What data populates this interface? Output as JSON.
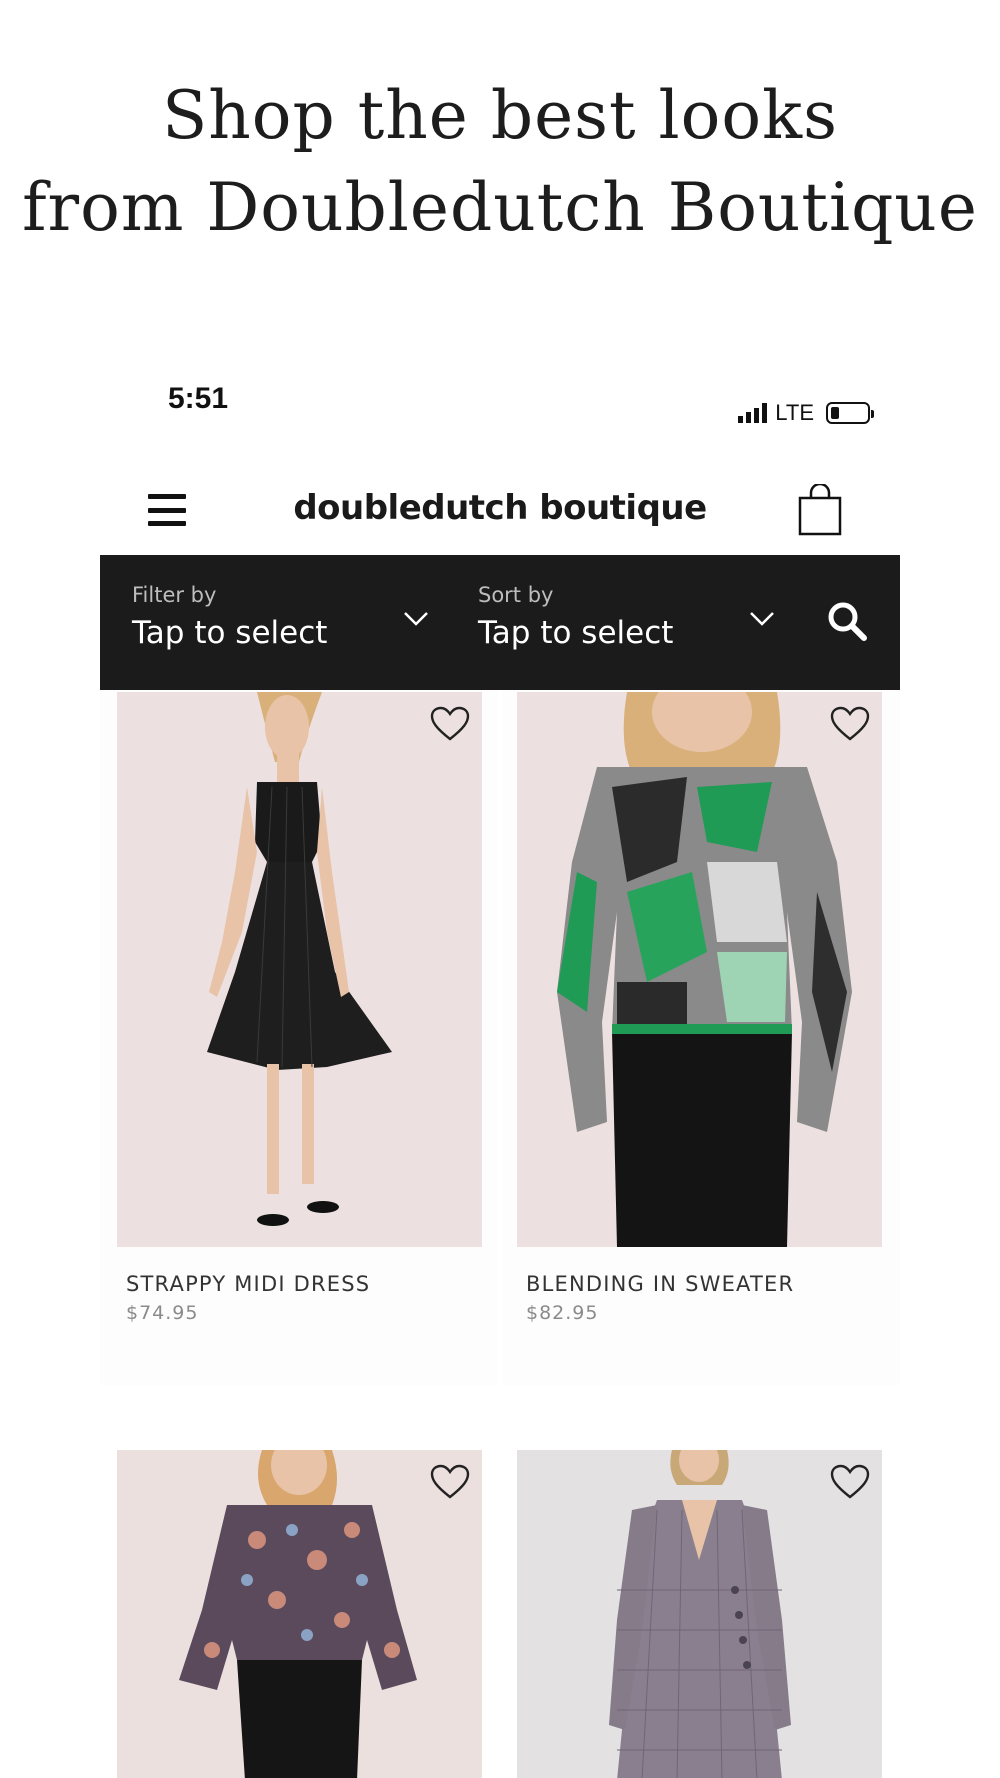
{
  "promo": {
    "line1": "Shop the best looks",
    "line2": "from Doubledutch Boutique"
  },
  "status_bar": {
    "time": "5:51",
    "network": "LTE"
  },
  "header": {
    "title": "doubledutch boutique"
  },
  "filter": {
    "label": "Filter by",
    "value": "Tap to select"
  },
  "sort": {
    "label": "Sort by",
    "value": "Tap to select"
  },
  "products": [
    {
      "name": "STRAPPY MIDI DRESS",
      "price": "$74.95"
    },
    {
      "name": "BLENDING IN SWEATER",
      "price": "$82.95"
    },
    {
      "name": "",
      "price": ""
    },
    {
      "name": "",
      "price": ""
    }
  ],
  "colors": {
    "filter_bar": "#1b1b1b",
    "photo_background": "#ece1e0",
    "price_text": "#8a8a8a"
  },
  "icons": [
    "menu-icon",
    "shopping-bag-icon",
    "chevron-down-icon",
    "search-icon",
    "heart-icon"
  ]
}
